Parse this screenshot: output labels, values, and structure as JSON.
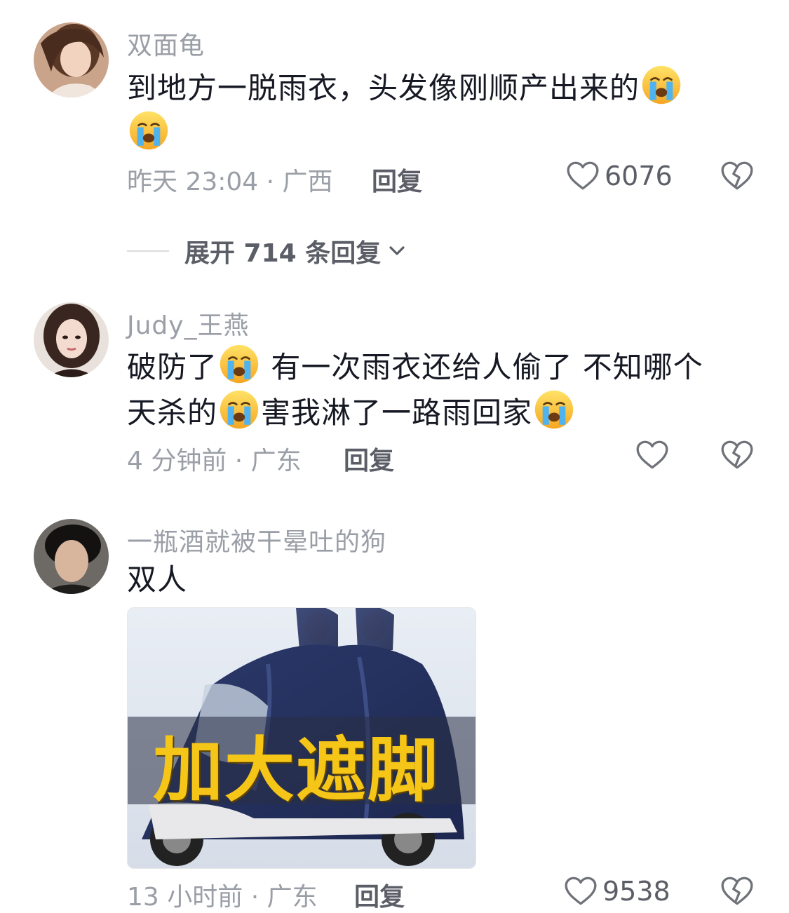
{
  "comments": [
    {
      "username": "双面龟",
      "text_parts": [
        "到地方一脱雨衣，头发像刚顺产出来的",
        "",
        ""
      ],
      "time_location": "昨天 23:04 · 广西",
      "reply_label": "回复",
      "likes": "6076"
    },
    {
      "username": "Judy_王燕",
      "text_a": "破防了",
      "text_b": " 有一次雨衣还给人偷了 不知哪个",
      "text_c": "天杀的",
      "text_d": "害我淋了一路雨回家",
      "time_location": "4 分钟前 · 广东",
      "reply_label": "回复"
    },
    {
      "username": "一瓶酒就被干晕吐的狗",
      "text": "双人",
      "image_caption": "加大遮脚",
      "time_location": "13 小时前 · 广东",
      "reply_label": "回复",
      "likes": "9538"
    }
  ],
  "expand_replies": "展开 714 条回复",
  "icons": {
    "heart": "heart-outline-icon",
    "dislike": "broken-heart-icon",
    "emoji": "loudly-crying-face-icon",
    "chevron": "chevron-down-icon"
  }
}
